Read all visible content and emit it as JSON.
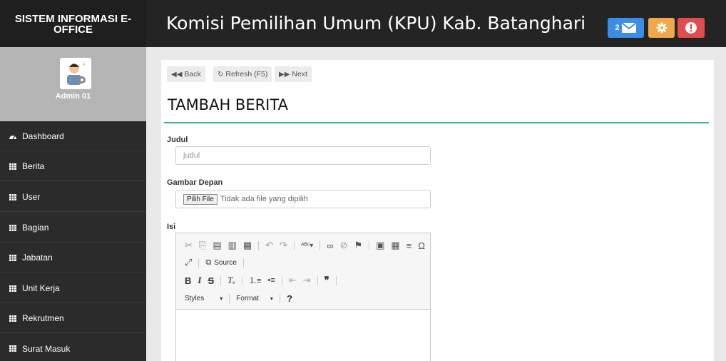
{
  "header": {
    "brand": "SISTEM INFORMASI E-OFFICE",
    "title": "Komisi Pemilihan Umum (KPU) Kab. Batanghari",
    "mail_count": "2",
    "colors": {
      "mail": "#3a8ee6",
      "settings": "#f0a84a",
      "alert": "#e14c4c",
      "accent": "#3fb48a"
    }
  },
  "sidebar": {
    "user_name": "Admin 01",
    "items": [
      {
        "label": "Dashboard",
        "icon": "dashboard-icon"
      },
      {
        "label": "Berita",
        "icon": "table-icon"
      },
      {
        "label": "User",
        "icon": "table-icon"
      },
      {
        "label": "Bagian",
        "icon": "table-icon"
      },
      {
        "label": "Jabatan",
        "icon": "table-icon"
      },
      {
        "label": "Unit Kerja",
        "icon": "table-icon"
      },
      {
        "label": "Rekrutmen",
        "icon": "table-icon"
      },
      {
        "label": "Surat Masuk",
        "icon": "table-icon"
      }
    ]
  },
  "actions": {
    "back": "Back",
    "refresh": "Refresh (F5)",
    "next": "Next"
  },
  "page": {
    "title": "TAMBAH BERITA"
  },
  "form": {
    "judul_label": "Judul",
    "judul_placeholder": "judul",
    "gambar_label": "Gambar Depan",
    "file_button": "Pilih File",
    "file_status": "Tidak ada file yang dipilih",
    "isi_label": "Isi",
    "editor": {
      "source_label": "Source",
      "styles_label": "Styles",
      "format_label": "Format"
    }
  }
}
